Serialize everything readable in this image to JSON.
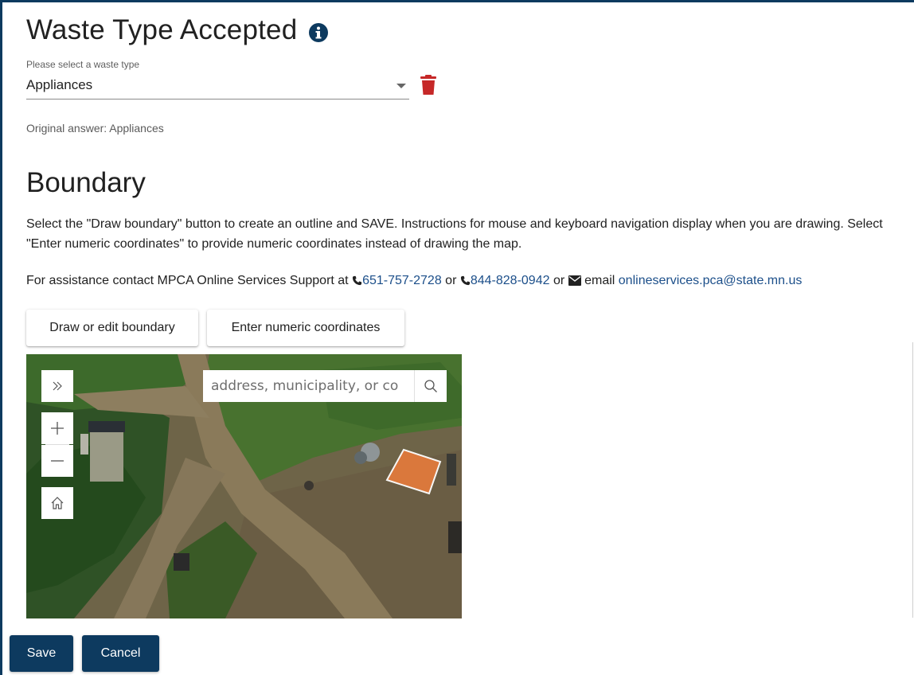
{
  "waste_section": {
    "title": "Waste Type Accepted",
    "select_label": "Please select a waste type",
    "selected_value": "Appliances",
    "original_answer": "Original answer: Appliances"
  },
  "boundary_section": {
    "title": "Boundary",
    "instructions": "Select the \"Draw boundary\" button to create an outline and SAVE. Instructions for mouse and keyboard navigation display when you are drawing. Select \"Enter numeric coordinates\" to provide numeric coordinates instead of drawing the map.",
    "assistance": {
      "prefix": "For assistance contact MPCA Online Services Support at",
      "phone1": "651-757-2728",
      "or1": "or",
      "phone2": "844-828-0942",
      "or2": "or",
      "email_label": "email",
      "email": "onlineservices.pca@state.mn.us"
    },
    "draw_button": "Draw or edit boundary",
    "coords_button": "Enter numeric coordinates"
  },
  "map": {
    "search_placeholder": "address, municipality, or co",
    "controls": [
      "expand-icon",
      "zoom-in-icon",
      "zoom-out-icon",
      "home-icon",
      "search-icon"
    ]
  },
  "footer": {
    "save_label": "Save",
    "cancel_label": "Cancel"
  },
  "colors": {
    "brand": "#0d3a5f",
    "link": "#1c4f8a",
    "danger": "#c62828",
    "polygon_fill": "#e07a3c"
  }
}
